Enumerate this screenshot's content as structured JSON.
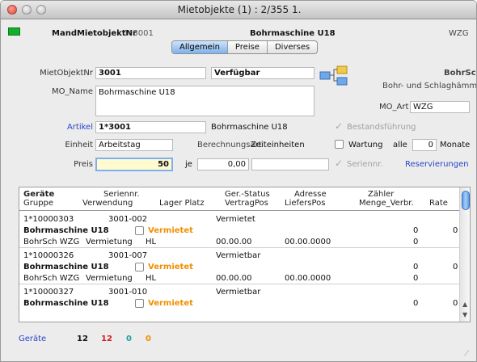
{
  "window": {
    "title": "Mietobjekte (1) : 2/355 1."
  },
  "header": {
    "label": "MandMietobjektNr",
    "nr": "1*3001",
    "name": "Bohrmaschine U18",
    "code": "WZG"
  },
  "tabs": [
    "Allgemein",
    "Preise",
    "Diverses"
  ],
  "form": {
    "mietobjektnr_label": "MietObjektNr",
    "mietobjektnr_value": "3001",
    "status_value": "Verfügbar",
    "art_code": "BohrSch",
    "art_desc": "Bohr- und Schlaghämmer",
    "mo_name_label": "MO_Name",
    "mo_name_value": "Bohrmaschine U18",
    "mo_art_label": "MO_Art",
    "mo_art_value": "WZG",
    "artikel_label": "Artikel",
    "artikel_value": "1*3001",
    "artikel_desc": "Bohrmaschine U18",
    "bestand_label": "Bestandsführung",
    "einheit_label": "Einheit",
    "einheit_value": "Arbeitstag",
    "berechnungsart_label": "Berechnungsart",
    "berechnungsart_value": "Zeiteinheiten",
    "wartung_label": "Wartung",
    "wartung_alle": "alle",
    "wartung_value": "0",
    "wartung_monate": "Monate",
    "preis_label": "Preis",
    "preis_value": "50",
    "je_label": "je",
    "je_value": "0,00",
    "seriennr_label": "Seriennr.",
    "reservierungen_label": "Reservierungen"
  },
  "list": {
    "headers": {
      "h1a": "Geräte",
      "h1b": "Gruppe",
      "h2a": "Seriennr.",
      "h2b": "Verwendung",
      "h3b": "Lager Platz",
      "h4a": "Ger.-Status",
      "h4b": "VertragPos",
      "h5a": "Adresse",
      "h5b": "LiefersPos",
      "h6a": "Zähler",
      "h6b": "Menge_Verbr.",
      "h7b": "Rate"
    },
    "rows": [
      {
        "nr": "1*10000303",
        "serial": "3001-002",
        "status": "Vermietet",
        "name": "Bohrmaschine U18",
        "state": "Vermietet",
        "zaehler": "0",
        "rate1": "0",
        "gruppe": "BohrSch WZG",
        "verwendung": "Vermietung",
        "lager": "HL",
        "vertrag": "00.00.00",
        "liefer": "00.00.0000",
        "menge": "0"
      },
      {
        "nr": "1*10000326",
        "serial": "3001-007",
        "status": "Vermietbar",
        "name": "Bohrmaschine U18",
        "state": "Vermietet",
        "zaehler": "0",
        "rate1": "0",
        "gruppe": "BohrSch WZG",
        "verwendung": "Vermietung",
        "lager": "HL",
        "vertrag": "00.00.00",
        "liefer": "00.00.0000",
        "menge": "0"
      },
      {
        "nr": "1*10000327",
        "serial": "3001-010",
        "status": "Vermietbar",
        "name": "Bohrmaschine U18",
        "state": "Vermietet",
        "zaehler": "0",
        "rate1": "0"
      }
    ]
  },
  "footer": {
    "label": "Geräte",
    "c1": "12",
    "c2": "12",
    "c3": "0",
    "c4": "0"
  },
  "colors": {
    "accent": "#2a44c8",
    "orange": "#f09000",
    "red": "#d02020",
    "teal": "#20a0a0",
    "green_flag": "#12b02a"
  }
}
